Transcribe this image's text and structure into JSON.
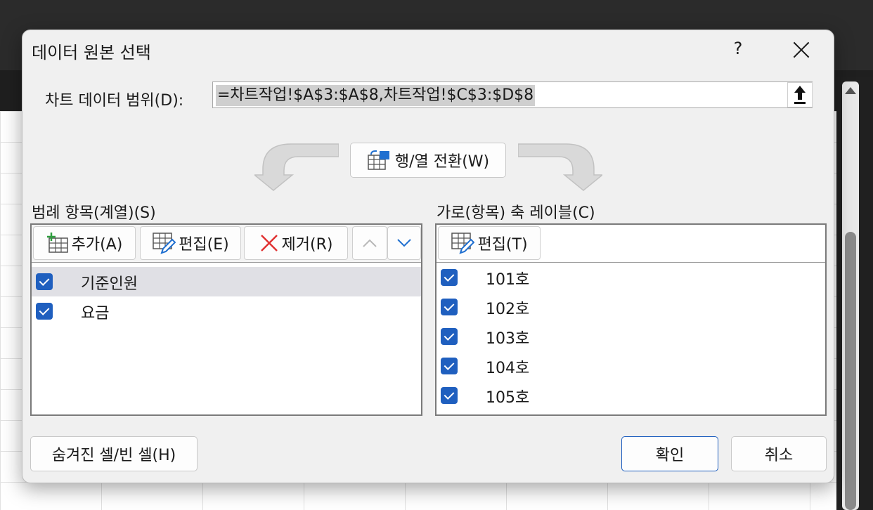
{
  "dialog": {
    "title": "데이터 원본 선택",
    "help": "?",
    "range_label": "차트 데이터 범위(D):",
    "range_value": "=차트작업!$A$3:$A$8,차트작업!$C$3:$D$8",
    "switch_button": "행/열 전환(W)"
  },
  "legend": {
    "label": "범례 항목(계열)(S)",
    "add": "추가(A)",
    "edit": "편집(E)",
    "remove": "제거(R)",
    "items": [
      "기준인원",
      "요금"
    ]
  },
  "axis": {
    "label": "가로(항목) 축 레이블(C)",
    "edit": "편집(T)",
    "items": [
      "101호",
      "102호",
      "103호",
      "104호",
      "105호"
    ]
  },
  "footer": {
    "hidden_cells": "숨겨진 셀/빈 셀(H)",
    "ok": "확인",
    "cancel": "취소"
  },
  "colors": {
    "accent": "#1f5fbf",
    "remove_x": "#e03131",
    "add_plus": "#2e9e3e"
  },
  "icons": [
    "close-icon",
    "collapse-dialog-icon",
    "switch-row-column-icon",
    "add-series-icon",
    "edit-series-icon",
    "remove-series-icon",
    "move-up-icon",
    "move-down-icon",
    "checkbox-icon"
  ]
}
